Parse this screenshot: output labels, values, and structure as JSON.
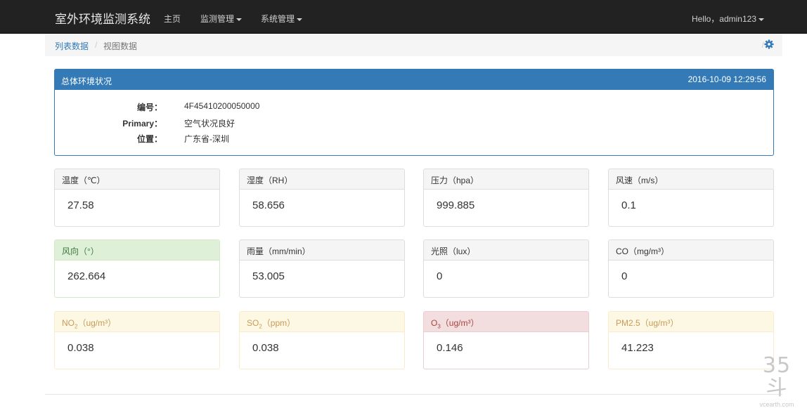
{
  "navbar": {
    "brand": "室外环境监测系统",
    "links": [
      {
        "label": "主页",
        "dropdown": false
      },
      {
        "label": "监测管理",
        "dropdown": true
      },
      {
        "label": "系统管理",
        "dropdown": true
      }
    ],
    "user": "Hello，admin123"
  },
  "breadcrumb": {
    "items": [
      "列表数据",
      "视图数据"
    ],
    "separator": "/",
    "settings_icon": "gear-icon"
  },
  "overview": {
    "title": "总体环境状况",
    "timestamp": "2016-10-09 12:29:56",
    "fields": [
      {
        "label": "编号：",
        "value": "4F45410200050000"
      },
      {
        "label": "Primary：",
        "value": "空气状况良好"
      },
      {
        "label": "位置：",
        "value": "广东省-深圳"
      }
    ]
  },
  "metrics": [
    {
      "label": "温度（℃）",
      "value": "27.58",
      "style": "default"
    },
    {
      "label": "湿度（RH）",
      "value": "58.656",
      "style": "default"
    },
    {
      "label": "压力（hpa）",
      "value": "999.885",
      "style": "default"
    },
    {
      "label": "风速（m/s）",
      "value": "0.1",
      "style": "default"
    },
    {
      "label": "风向（°）",
      "value": "262.664",
      "style": "success"
    },
    {
      "label": "雨量（mm/min）",
      "value": "53.005",
      "style": "default"
    },
    {
      "label": "光照（lux）",
      "value": "0",
      "style": "default"
    },
    {
      "label": "CO（mg/m³）",
      "value": "0",
      "style": "default"
    },
    {
      "label_main": "NO",
      "label_sub": "2",
      "label_rest": "（ug/m³）",
      "value": "0.038",
      "style": "warning"
    },
    {
      "label_main": "SO",
      "label_sub": "2",
      "label_rest": "（ppm）",
      "value": "0.038",
      "style": "warning"
    },
    {
      "label_main": "O",
      "label_sub": "3",
      "label_rest": "（ug/m³）",
      "value": "0.146",
      "style": "danger"
    },
    {
      "label": "PM2.5（ug/m³）",
      "value": "41.223",
      "style": "warning"
    }
  ],
  "watermark": {
    "big": "35斗",
    "small": "vcearth.com"
  },
  "colors": {
    "navbar": "#222222",
    "primary": "#337ab7",
    "success_bg": "#dff0d8",
    "warning_bg": "#fcf8e3",
    "danger_bg": "#f2dede"
  }
}
